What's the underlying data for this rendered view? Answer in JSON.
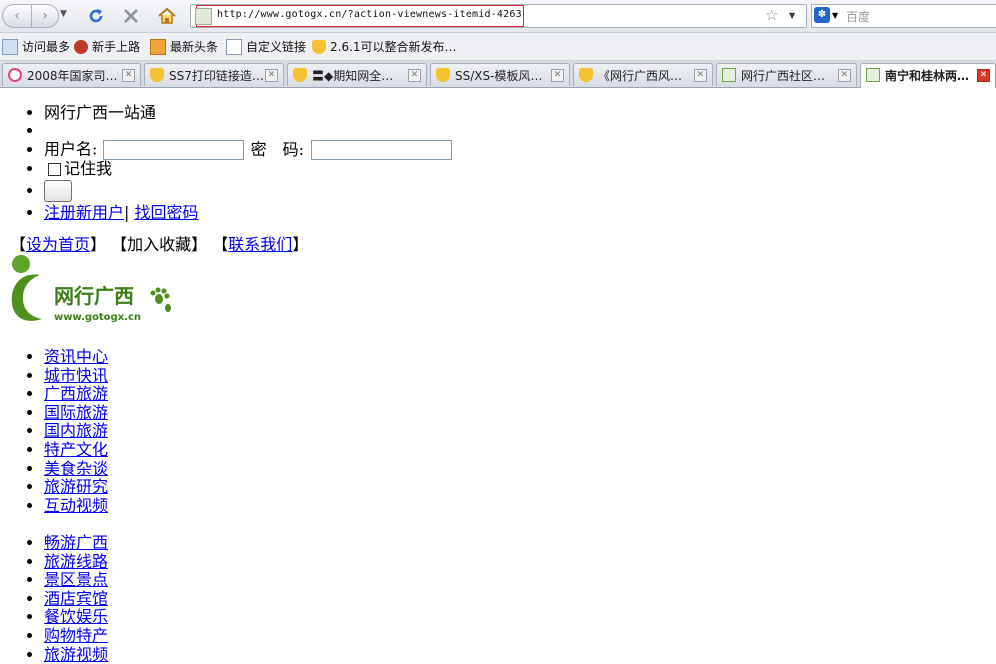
{
  "browser": {
    "url": "http://www.gotogx.cn/?action-viewnews-itemid-4263",
    "search_placeholder": "百度",
    "bookmarks": [
      "访问最多",
      "新手上路",
      "最新头条",
      "自定义链接",
      "2.6.1可以整合新发布…"
    ],
    "tabs": [
      {
        "label": "2008年国家司…"
      },
      {
        "label": "SS7打印链接造…"
      },
      {
        "label": "〓◆期知网全…"
      },
      {
        "label": "SS/XS-模板风…"
      },
      {
        "label": "《网行广西风…"
      },
      {
        "label": "网行广西社区…"
      },
      {
        "label": "南宁和桂林两…",
        "active": true
      }
    ]
  },
  "login": {
    "title": "网行广西一站通",
    "username_label": "用户名:",
    "password_label": "密　码:",
    "remember_label": "记住我",
    "register_link": "注册新用户",
    "divider": "|",
    "forgot_link": "找回密码"
  },
  "toplinks": {
    "home": "设为首页",
    "favorite": "加入收藏",
    "contact": "联系我们"
  },
  "logo": {
    "name": "网行广西",
    "domain": "www.gotogx.cn"
  },
  "nav_primary": [
    "资讯中心",
    "城市快讯",
    "广西旅游",
    "国际旅游",
    "国内旅游",
    "特产文化",
    "美食杂谈",
    "旅游研究",
    "互动视频"
  ],
  "nav_secondary": [
    "畅游广西",
    "旅游线路",
    "景区景点",
    "酒店宾馆",
    "餐饮娱乐",
    "购物特产",
    "旅游视频"
  ]
}
